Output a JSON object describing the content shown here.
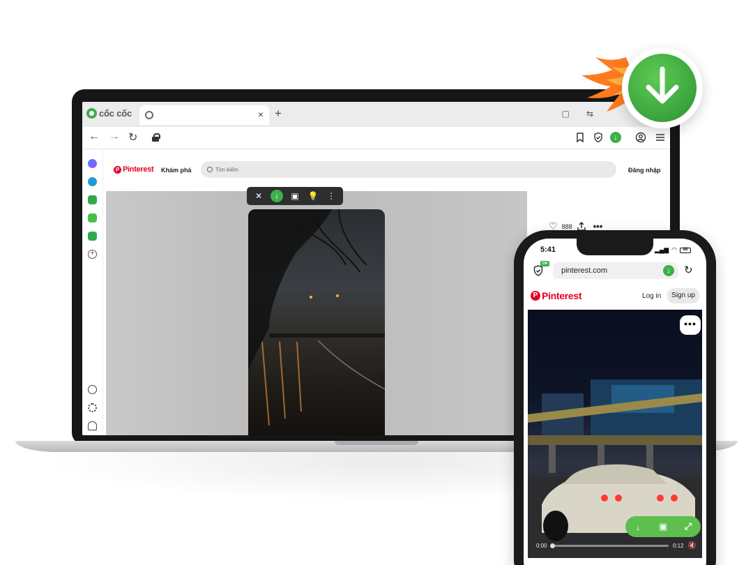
{
  "browser": {
    "brand": "cốc cốc",
    "tab_close": "×",
    "new_tab": "+",
    "address": ""
  },
  "desktop_page": {
    "pinterest_word": "Pinterest",
    "nav_explore": "Khám phá",
    "search_placeholder": "Tìm kiếm",
    "login": "Đăng nhập",
    "like_count": "888"
  },
  "phone": {
    "time": "5:41",
    "battery": "88",
    "on_badge": "ON",
    "url": "pinterest.com",
    "pinterest_word": "Pinterest",
    "login": "Log in",
    "signup": "Sign up",
    "time_current": "0:00",
    "time_total": "0:12",
    "progress": 0
  },
  "colors": {
    "accent_green": "#3cb04a",
    "pinterest_red": "#e60023",
    "flame_orange": "#ff6a1a"
  }
}
